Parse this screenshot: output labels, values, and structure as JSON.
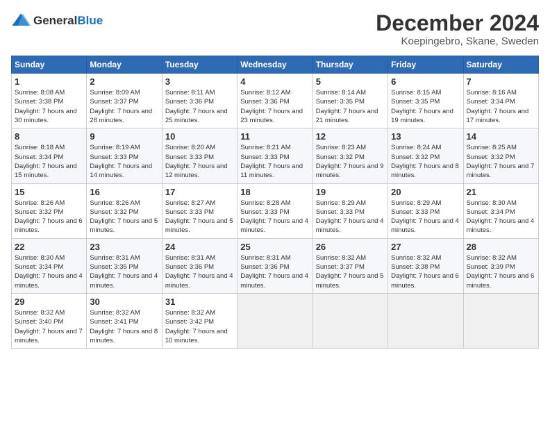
{
  "header": {
    "logo_general": "General",
    "logo_blue": "Blue",
    "month_title": "December 2024",
    "location": "Koepingebro, Skane, Sweden"
  },
  "weekdays": [
    "Sunday",
    "Monday",
    "Tuesday",
    "Wednesday",
    "Thursday",
    "Friday",
    "Saturday"
  ],
  "weeks": [
    [
      {
        "day": "1",
        "sunrise": "8:08 AM",
        "sunset": "3:38 PM",
        "daylight": "7 hours and 30 minutes."
      },
      {
        "day": "2",
        "sunrise": "8:09 AM",
        "sunset": "3:37 PM",
        "daylight": "7 hours and 28 minutes."
      },
      {
        "day": "3",
        "sunrise": "8:11 AM",
        "sunset": "3:36 PM",
        "daylight": "7 hours and 25 minutes."
      },
      {
        "day": "4",
        "sunrise": "8:12 AM",
        "sunset": "3:36 PM",
        "daylight": "7 hours and 23 minutes."
      },
      {
        "day": "5",
        "sunrise": "8:14 AM",
        "sunset": "3:35 PM",
        "daylight": "7 hours and 21 minutes."
      },
      {
        "day": "6",
        "sunrise": "8:15 AM",
        "sunset": "3:35 PM",
        "daylight": "7 hours and 19 minutes."
      },
      {
        "day": "7",
        "sunrise": "8:16 AM",
        "sunset": "3:34 PM",
        "daylight": "7 hours and 17 minutes."
      }
    ],
    [
      {
        "day": "8",
        "sunrise": "8:18 AM",
        "sunset": "3:34 PM",
        "daylight": "7 hours and 15 minutes."
      },
      {
        "day": "9",
        "sunrise": "8:19 AM",
        "sunset": "3:33 PM",
        "daylight": "7 hours and 14 minutes."
      },
      {
        "day": "10",
        "sunrise": "8:20 AM",
        "sunset": "3:33 PM",
        "daylight": "7 hours and 12 minutes."
      },
      {
        "day": "11",
        "sunrise": "8:21 AM",
        "sunset": "3:33 PM",
        "daylight": "7 hours and 11 minutes."
      },
      {
        "day": "12",
        "sunrise": "8:23 AM",
        "sunset": "3:32 PM",
        "daylight": "7 hours and 9 minutes."
      },
      {
        "day": "13",
        "sunrise": "8:24 AM",
        "sunset": "3:32 PM",
        "daylight": "7 hours and 8 minutes."
      },
      {
        "day": "14",
        "sunrise": "8:25 AM",
        "sunset": "3:32 PM",
        "daylight": "7 hours and 7 minutes."
      }
    ],
    [
      {
        "day": "15",
        "sunrise": "8:26 AM",
        "sunset": "3:32 PM",
        "daylight": "7 hours and 6 minutes."
      },
      {
        "day": "16",
        "sunrise": "8:26 AM",
        "sunset": "3:32 PM",
        "daylight": "7 hours and 5 minutes."
      },
      {
        "day": "17",
        "sunrise": "8:27 AM",
        "sunset": "3:33 PM",
        "daylight": "7 hours and 5 minutes."
      },
      {
        "day": "18",
        "sunrise": "8:28 AM",
        "sunset": "3:33 PM",
        "daylight": "7 hours and 4 minutes."
      },
      {
        "day": "19",
        "sunrise": "8:29 AM",
        "sunset": "3:33 PM",
        "daylight": "7 hours and 4 minutes."
      },
      {
        "day": "20",
        "sunrise": "8:29 AM",
        "sunset": "3:33 PM",
        "daylight": "7 hours and 4 minutes."
      },
      {
        "day": "21",
        "sunrise": "8:30 AM",
        "sunset": "3:34 PM",
        "daylight": "7 hours and 4 minutes."
      }
    ],
    [
      {
        "day": "22",
        "sunrise": "8:30 AM",
        "sunset": "3:34 PM",
        "daylight": "7 hours and 4 minutes."
      },
      {
        "day": "23",
        "sunrise": "8:31 AM",
        "sunset": "3:35 PM",
        "daylight": "7 hours and 4 minutes."
      },
      {
        "day": "24",
        "sunrise": "8:31 AM",
        "sunset": "3:36 PM",
        "daylight": "7 hours and 4 minutes."
      },
      {
        "day": "25",
        "sunrise": "8:31 AM",
        "sunset": "3:36 PM",
        "daylight": "7 hours and 4 minutes."
      },
      {
        "day": "26",
        "sunrise": "8:32 AM",
        "sunset": "3:37 PM",
        "daylight": "7 hours and 5 minutes."
      },
      {
        "day": "27",
        "sunrise": "8:32 AM",
        "sunset": "3:38 PM",
        "daylight": "7 hours and 6 minutes."
      },
      {
        "day": "28",
        "sunrise": "8:32 AM",
        "sunset": "3:39 PM",
        "daylight": "7 hours and 6 minutes."
      }
    ],
    [
      {
        "day": "29",
        "sunrise": "8:32 AM",
        "sunset": "3:40 PM",
        "daylight": "7 hours and 7 minutes."
      },
      {
        "day": "30",
        "sunrise": "8:32 AM",
        "sunset": "3:41 PM",
        "daylight": "7 hours and 8 minutes."
      },
      {
        "day": "31",
        "sunrise": "8:32 AM",
        "sunset": "3:42 PM",
        "daylight": "7 hours and 10 minutes."
      },
      null,
      null,
      null,
      null
    ]
  ]
}
